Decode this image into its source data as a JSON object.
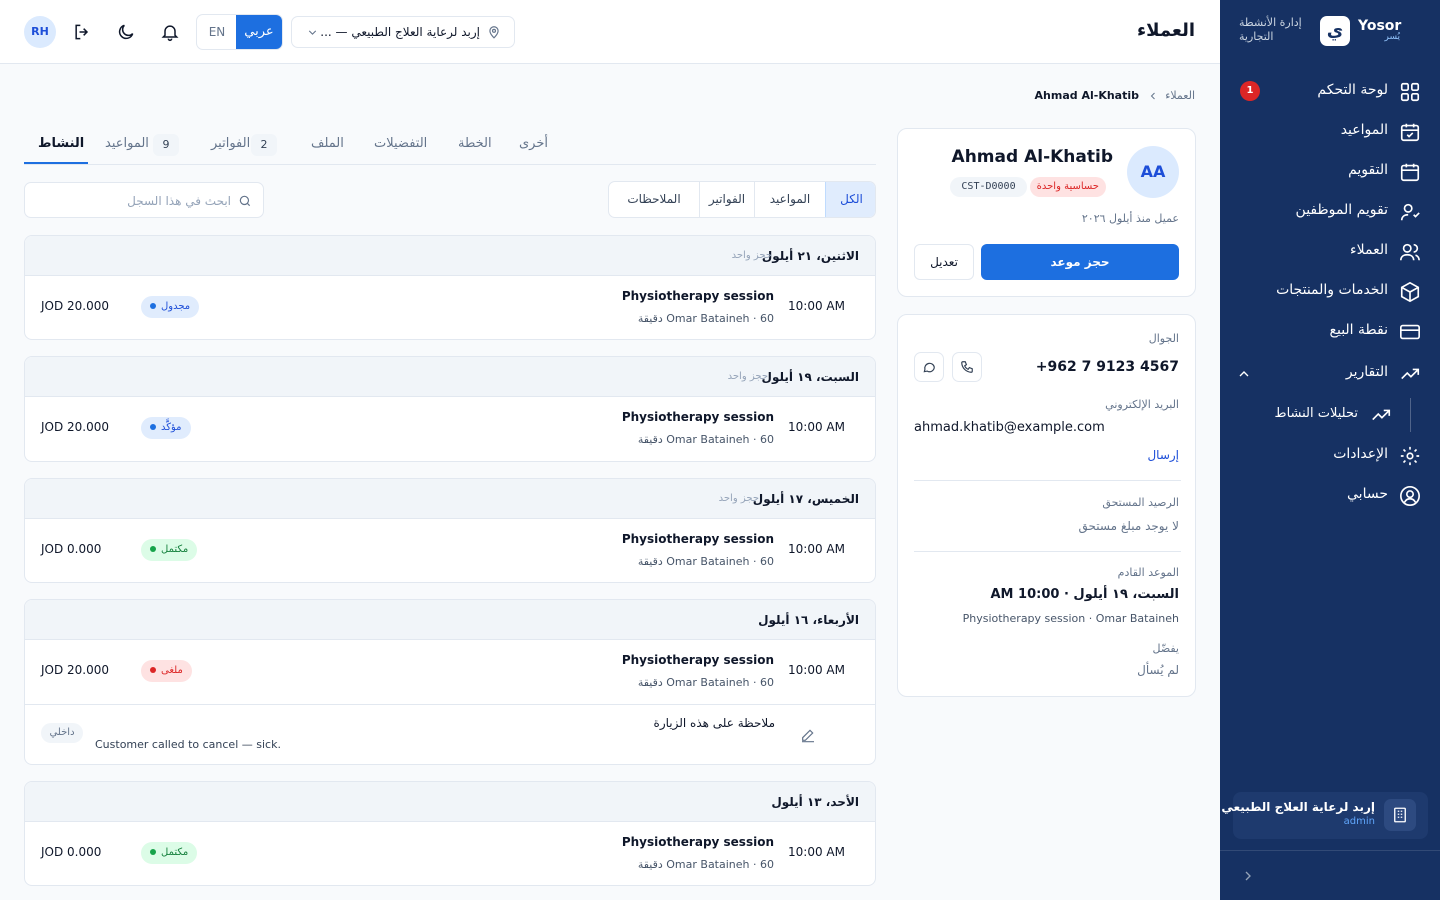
{
  "brand": {
    "name": "Yosor",
    "sub": "يُسر",
    "tagline": "إدارة الأنشطة التجارية",
    "logo": "ي"
  },
  "header": {
    "title": "العملاء",
    "avatar": "RH",
    "lang_ar": "عربي",
    "lang_en": "EN",
    "location": "إربد لرعاية العلاج الطبيعي — ..."
  },
  "sidebar": {
    "items": [
      {
        "label": "لوحة التحكم",
        "icon": "dashboard-icon",
        "badge": "1"
      },
      {
        "label": "المواعيد",
        "icon": "calendar-check-icon"
      },
      {
        "label": "التقويم",
        "icon": "calendar-icon"
      },
      {
        "label": "تقويم الموظفين",
        "icon": "staff-calendar-icon"
      },
      {
        "label": "العملاء",
        "icon": "users-icon"
      },
      {
        "label": "الخدمات والمنتجات",
        "icon": "box-icon"
      },
      {
        "label": "نقطة البيع",
        "icon": "card-icon"
      },
      {
        "label": "التقارير",
        "icon": "trend-icon"
      }
    ],
    "sub_item": {
      "label": "تحليلات النشاط",
      "icon": "trend-icon"
    },
    "bottom_items": [
      {
        "label": "الإعدادات",
        "icon": "gear-icon"
      },
      {
        "label": "حسابي",
        "icon": "account-icon"
      }
    ],
    "org": {
      "name": "إربد لرعاية العلاج الطبيعي",
      "role": "admin"
    }
  },
  "breadcrumb": {
    "root": "العملاء",
    "current": "Ahmad Al-Khatib"
  },
  "profile": {
    "initials": "AA",
    "name": "Ahmad Al-Khatib",
    "tag": "حساسية واحدة",
    "id": "CST-D0000",
    "since": "عميل منذ أيلول ٢٠٢٦",
    "book_label": "حجز موعد",
    "edit_label": "تعديل"
  },
  "contact": {
    "phone_label": "الجوال",
    "phone": "+962 7 9123 4567",
    "email_label": "البريد الإلكتروني",
    "email": "ahmad.khatib@example.com",
    "send_label": "إرسال",
    "balance_label": "الرصيد المستحق",
    "balance_value": "لا يوجد مبلغ مستحق",
    "next_label": "الموعد القادم",
    "next_date": "السبت، ١٩ أيلول · 10:00 AM",
    "next_desc": "Physiotherapy session · Omar Bataineh",
    "prefers_label": "يفضّل",
    "prefers_value": "لم يُسأل"
  },
  "tabs": [
    {
      "label": "النشاط",
      "active": true
    },
    {
      "label": "المواعيد",
      "count": "9"
    },
    {
      "label": "الفواتير",
      "count": "2"
    },
    {
      "label": "الملف"
    },
    {
      "label": "التفضيلات"
    },
    {
      "label": "الخطة"
    },
    {
      "label": "أخرى"
    }
  ],
  "filters": [
    {
      "label": "الكل",
      "active": true
    },
    {
      "label": "المواعيد"
    },
    {
      "label": "الفواتير"
    },
    {
      "label": "الملاحظات"
    }
  ],
  "search": {
    "placeholder": "ابحث في هذا السجل"
  },
  "activities": [
    {
      "date": "الاثنين، ٢١ أيلول",
      "kind": "حجز واحد",
      "time": "10:00 AM",
      "title": "Physiotherapy session",
      "sub": "Omar Bataineh · 60 دقيقة",
      "amount": "JOD 20.000",
      "status": "مجدول",
      "status_color": "blue"
    },
    {
      "date": "السبت، ١٩ أيلول",
      "kind": "حجز واحد",
      "time": "10:00 AM",
      "title": "Physiotherapy session",
      "sub": "Omar Bataineh · 60 دقيقة",
      "amount": "JOD 20.000",
      "status": "مؤكَّد",
      "status_color": "blue"
    },
    {
      "date": "الخميس، ١٧ أيلول",
      "kind": "حجز واحد",
      "time": "10:00 AM",
      "title": "Physiotherapy session",
      "sub": "Omar Bataineh · 60 دقيقة",
      "amount": "JOD 0.000",
      "status": "مكتمل",
      "status_color": "green"
    },
    {
      "date": "الأربعاء، ١٦ أيلول",
      "kind": "",
      "time": "10:00 AM",
      "title": "Physiotherapy session",
      "sub": "Omar Bataineh · 60 دقيقة",
      "amount": "JOD 20.000",
      "status": "ملغى",
      "status_color": "red",
      "note": {
        "title": "ملاحظة على هذه الزيارة",
        "text": "Customer called to cancel — sick.",
        "tag": "داخلي"
      }
    },
    {
      "date": "الأحد، ١٣ أيلول",
      "kind": "",
      "time": "10:00 AM",
      "title": "Physiotherapy session",
      "sub": "Omar Bataineh · 60 دقيقة",
      "amount": "JOD 0.000",
      "status": "مكتمل",
      "status_color": "green"
    }
  ]
}
